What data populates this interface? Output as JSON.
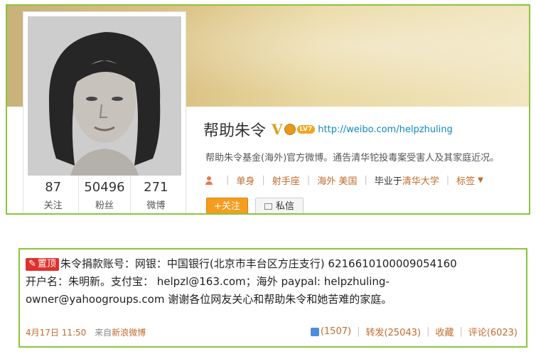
{
  "profile": {
    "name": "帮助朱令",
    "verified_icon": "V",
    "level_badge": "LV7",
    "url": "http://weibo.com/helpzhuling",
    "description": "帮助朱令基金(海外)官方微博。通告清华铊投毒案受害人及其家庭近况。",
    "info": {
      "relationship": "单身",
      "zodiac": "射手座",
      "location": "海外 美国",
      "education_prefix": "毕业于",
      "school": "清华大学",
      "tags_label": "标签"
    },
    "stats": [
      {
        "num": "87",
        "label": "关注"
      },
      {
        "num": "50496",
        "label": "粉丝"
      },
      {
        "num": "271",
        "label": "微博"
      }
    ],
    "buttons": {
      "follow": "+关注",
      "message": "私信"
    }
  },
  "post": {
    "pin_label": "置顶",
    "line1": "朱令捐款账号：网银：中国银行(北京市丰台区方庄支行) 6216610100009054160",
    "line2": "开户名：朱明新。支付宝： helpzl@163.com；海外 paypal: helpzhuling-",
    "line3": "owner@yahoogroups.com 谢谢各位网友关心和帮助朱令和她苦难的家庭。",
    "time": "4月17日 11:50",
    "from_prefix": "来自",
    "source": "新浪微博",
    "likes": "(1507)",
    "repost": "转发(25043)",
    "favorite": "收藏",
    "comment": "评论(6023)"
  },
  "colors": {
    "border": "#8cc43c",
    "follow_button": "#f49d1f",
    "pin_badge": "#e0302c",
    "link": "#c06b2b"
  }
}
